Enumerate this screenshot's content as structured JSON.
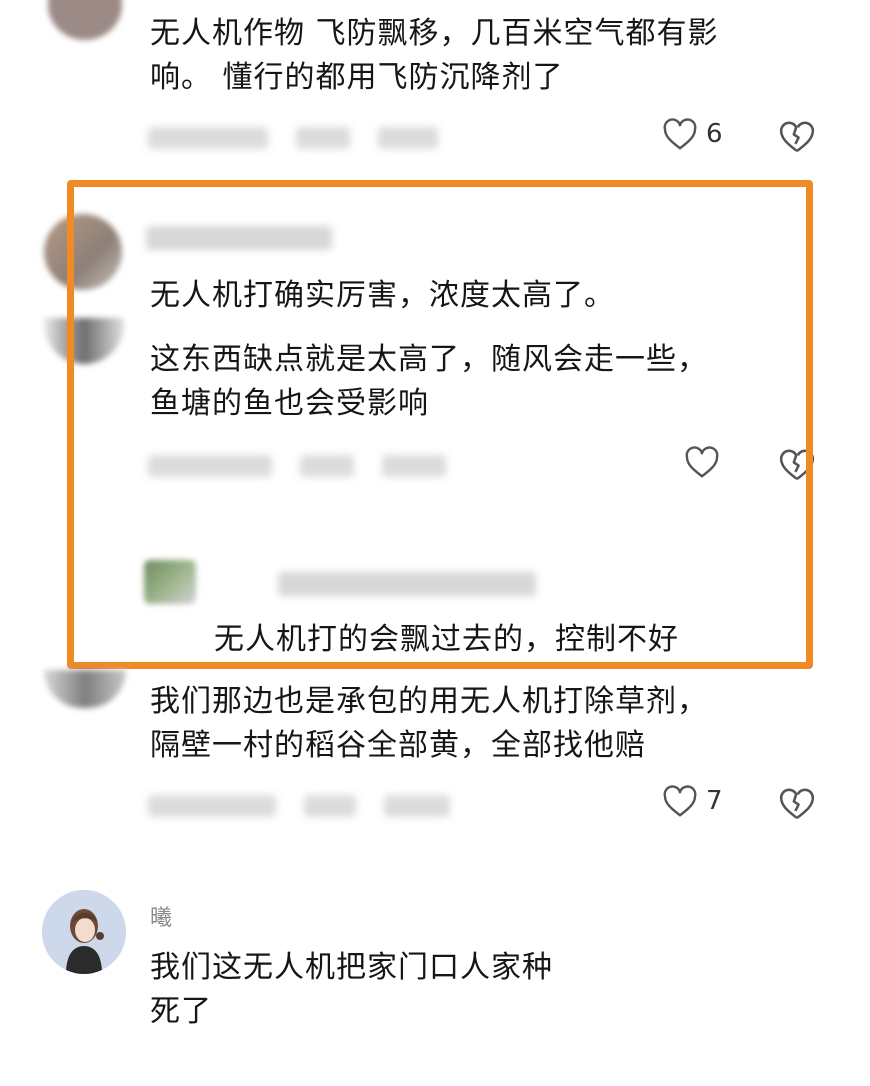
{
  "colors": {
    "highlight": "#f08a24",
    "text": "#161616",
    "icon": "#555555"
  },
  "comments": [
    {
      "lines": [
        "无人机作物 飞防飘移，几百米空气都有影",
        "响。 懂行的都用飞防沉降剂了"
      ],
      "likes": "6"
    },
    {
      "lines": [
        "无人机打确实厉害，浓度太高了。"
      ]
    },
    {
      "lines": [
        "这东西缺点就是太高了，随风会走一些，",
        "鱼塘的鱼也会受影响"
      ]
    },
    {
      "reply": "无人机打的会飘过去的，控制不好"
    },
    {
      "lines": [
        "我们那边也是承包的用无人机打除草剂，",
        "隔壁一村的稻谷全部黄，全部找他赔"
      ],
      "likes": "7"
    },
    {
      "username": "曦",
      "lines": [
        "我们这无人机把家门口人家种",
        "死了"
      ]
    }
  ],
  "icons": {
    "like": "heart-outline-icon",
    "dislike": "broken-heart-icon"
  }
}
